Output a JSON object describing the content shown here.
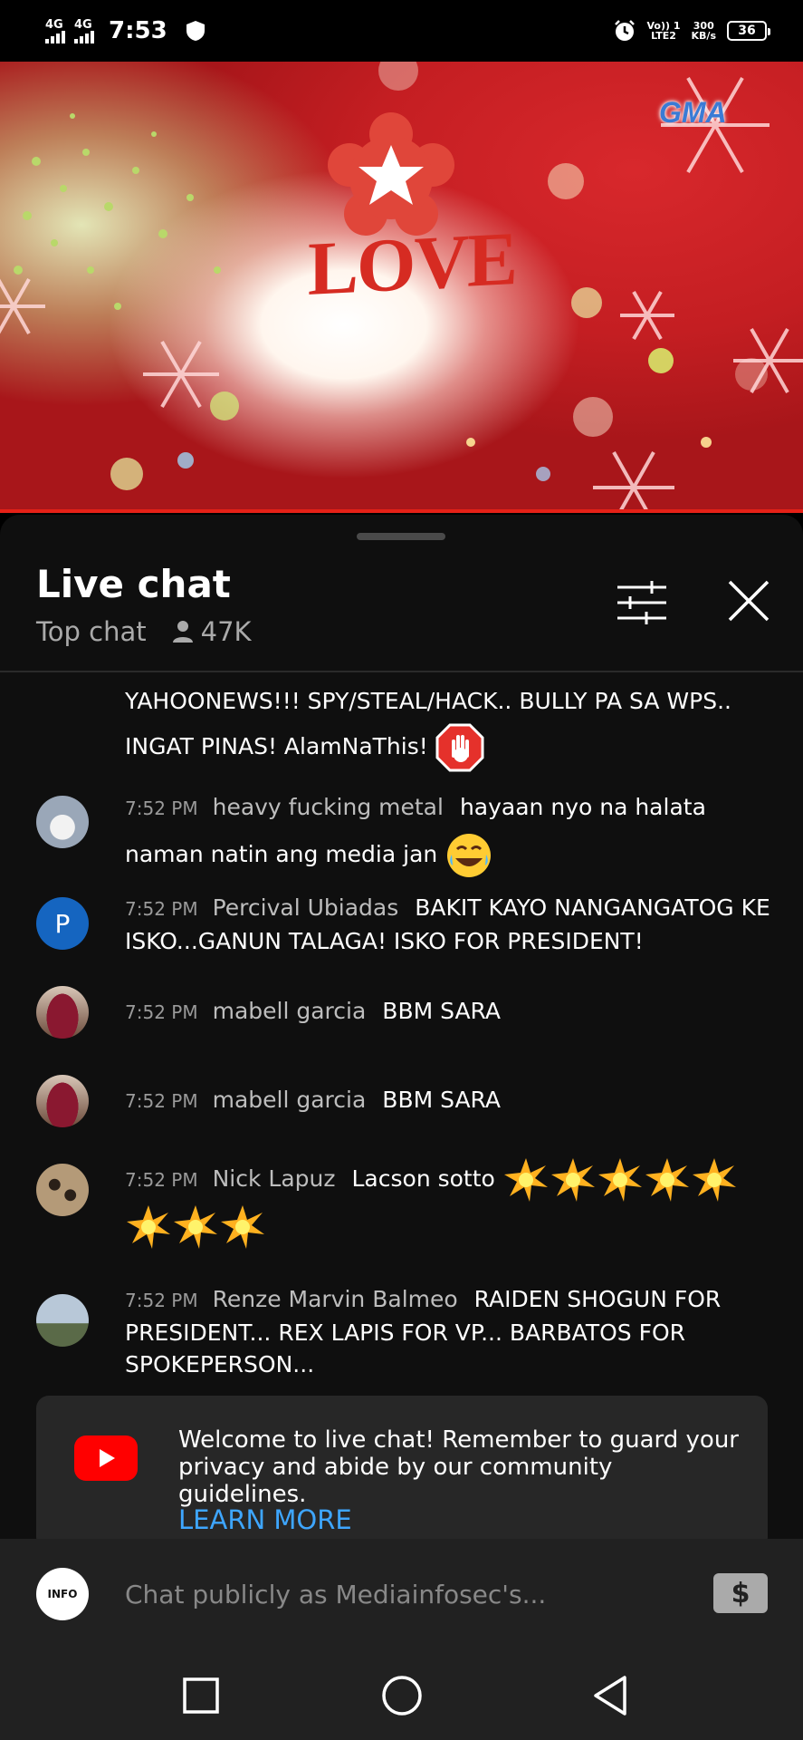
{
  "status_bar": {
    "sim1": "4G",
    "sim2": "4G",
    "time": "7:53",
    "volte_line1": "Vo)) 1",
    "volte_line2": "LTE2",
    "speed_line1": "300",
    "speed_line2": "KB/s",
    "battery": "36"
  },
  "video": {
    "watermark": "GMA",
    "title_graphic": "LOVE"
  },
  "chat": {
    "title": "Live chat",
    "mode": "Top chat",
    "viewers": "47K",
    "top_message_line1": "YAHOONEWS!!! SPY/STEAL/HACK.. BULLY PA SA WPS..",
    "top_message_line2": "INGAT PINAS! AlamNaThis!",
    "messages": [
      {
        "time": "7:52 PM",
        "author": "heavy fucking metal",
        "text": "hayaan nyo na halata naman natin ang media jan"
      },
      {
        "time": "7:52 PM",
        "author": "Percival Ubiadas",
        "text": "BAKIT KAYO NANGANGATOG KE ISKO...GANUN TALAGA! ISKO FOR PRESIDENT!",
        "initial": "P"
      },
      {
        "time": "7:52 PM",
        "author": "mabell garcia",
        "text": "BBM SARA"
      },
      {
        "time": "7:52 PM",
        "author": "mabell garcia",
        "text": "BBM SARA"
      },
      {
        "time": "7:52 PM",
        "author": "Nick Lapuz",
        "text": "Lacson sotto"
      },
      {
        "time": "7:52 PM",
        "author": "Renze Marvin Balmeo",
        "text": "RAIDEN SHOGUN FOR PRESIDENT... REX LAPIS FOR VP... BARBATOS FOR SPOKEPERSON..."
      }
    ],
    "welcome_text": "Welcome to live chat! Remember to guard your privacy and abide by our community guidelines.",
    "learn_more": "LEARN MORE",
    "input_placeholder": "Chat publicly as Mediainfosec's...",
    "my_avatar_text": "INFO",
    "superchat_symbol": "$"
  },
  "colors": {
    "panel_bg": "#0f0f0f",
    "link": "#3ea6ff",
    "progress": "#e62117",
    "youtube_red": "#ff0000"
  }
}
